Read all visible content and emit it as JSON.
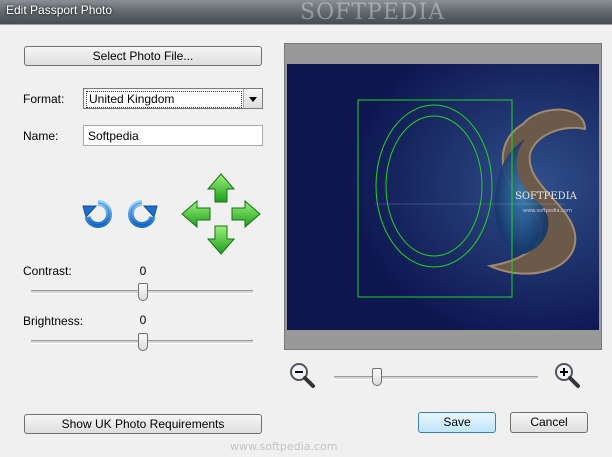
{
  "window": {
    "title": "Edit Passport Photo",
    "watermark": "SOFTPEDIA"
  },
  "buttons": {
    "select_photo": "Select Photo File...",
    "requirements": "Show UK Photo Requirements",
    "save": "Save",
    "cancel": "Cancel"
  },
  "format": {
    "label": "Format:",
    "value": "United Kingdom"
  },
  "name": {
    "label": "Name:",
    "value": "Softpedia"
  },
  "contrast": {
    "label": "Contrast:",
    "value": "0"
  },
  "brightness": {
    "label": "Brightness:",
    "value": "0"
  },
  "preview": {
    "brand_text": "SOFTPEDIA",
    "url_text": "www.softpedia.com"
  },
  "footer_watermark": "www.softpedia.com",
  "icons": [
    "rotate-left-icon",
    "rotate-right-icon",
    "move-up-icon",
    "move-left-icon",
    "move-right-icon",
    "move-down-icon",
    "zoom-out-icon",
    "zoom-in-icon"
  ],
  "colors": {
    "accent": "#3c7fb1",
    "guide": "#22d322",
    "arrow": "#3cc43c"
  }
}
